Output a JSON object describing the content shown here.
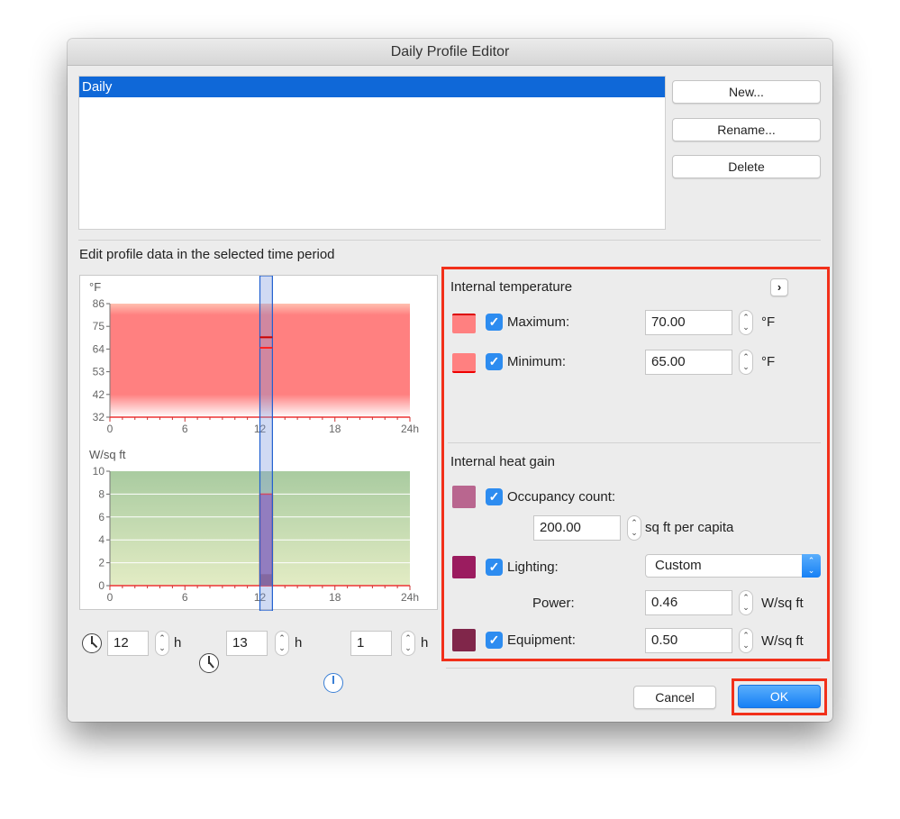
{
  "window": {
    "title": "Daily Profile Editor"
  },
  "profiles": {
    "items": [
      {
        "label": "Daily",
        "selected": true
      }
    ]
  },
  "buttons": {
    "new": "New...",
    "rename": "Rename...",
    "delete": "Delete",
    "cancel": "Cancel",
    "ok": "OK"
  },
  "section_label": "Edit profile data in the selected time period",
  "charts": {
    "temperature": {
      "unit_label": "°F",
      "y_ticks": [
        "86",
        "75",
        "64",
        "53",
        "42",
        "32"
      ],
      "x_ticks": [
        "0",
        "6",
        "12",
        "18",
        "24h"
      ],
      "ylim": [
        32,
        86
      ],
      "xlim": [
        0,
        24
      ],
      "maximum": 70,
      "minimum": 65,
      "fill_color": "#ff8080"
    },
    "heat_gain": {
      "unit_label": "W/sq ft",
      "y_ticks": [
        "10",
        "8",
        "6",
        "4",
        "2",
        "0"
      ],
      "x_ticks": [
        "0",
        "6",
        "12",
        "18",
        "24h"
      ],
      "ylim": [
        0,
        10
      ],
      "xlim": [
        0,
        24
      ],
      "bar_value": 8,
      "occupancy_value": 1,
      "fill_top": "#a9cba0",
      "fill_bottom": "#e3ecc4"
    },
    "selection": {
      "start": 12,
      "end": 13
    }
  },
  "time": {
    "start": "12",
    "end": "13",
    "duration": "1",
    "unit": "h"
  },
  "internal_temperature": {
    "title": "Internal temperature",
    "expand_icon": "chevron-right-icon",
    "maximum": {
      "label": "Maximum:",
      "value": "70.00",
      "unit": "°F",
      "checked": true,
      "color": "#ff8080"
    },
    "minimum": {
      "label": "Minimum:",
      "value": "65.00",
      "unit": "°F",
      "checked": true,
      "color": "#ff8080"
    }
  },
  "internal_heat_gain": {
    "title": "Internal heat gain",
    "occupancy": {
      "label": "Occupancy count:",
      "value": "200.00",
      "unit": "sq ft per capita",
      "checked": true,
      "color": "#b9668f"
    },
    "lighting": {
      "label": "Lighting:",
      "selected": "Custom",
      "checked": true,
      "color": "#9b1c5f",
      "power_label": "Power:",
      "power_value": "0.46",
      "power_unit": "W/sq ft"
    },
    "equipment": {
      "label": "Equipment:",
      "value": "0.50",
      "unit": "W/sq ft",
      "checked": true,
      "color": "#80264a"
    }
  }
}
